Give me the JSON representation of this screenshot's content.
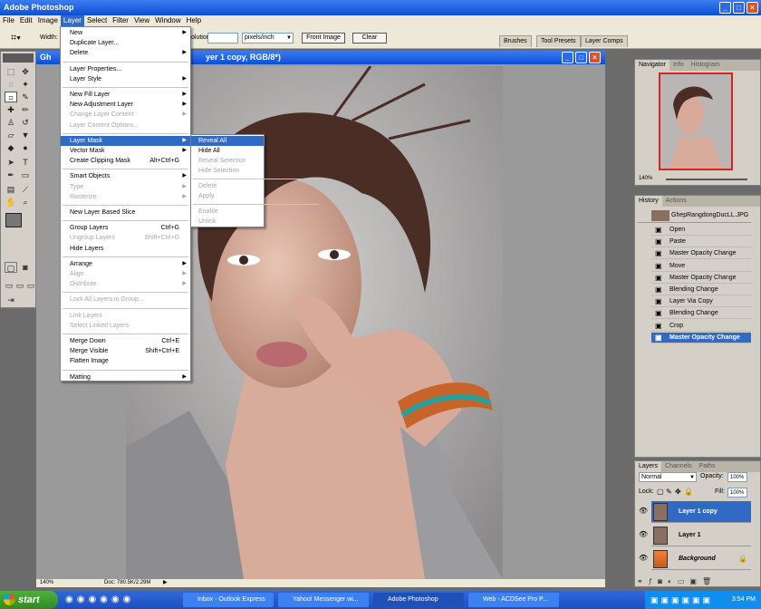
{
  "app": {
    "title": "Adobe Photoshop"
  },
  "menubar": [
    "File",
    "Edit",
    "Image",
    "Layer",
    "Select",
    "Filter",
    "View",
    "Window",
    "Help"
  ],
  "options": {
    "width_label": "Width:",
    "resolution_label": "olution:",
    "unit_select": "pixels/inch",
    "front_image_button": "Front Image",
    "clear_button": "Clear",
    "palette_tabs": [
      "Brushes",
      "Tool Presets",
      "Layer Comps"
    ]
  },
  "document": {
    "title": "Gh",
    "title_suffix": "yer 1 copy, RGB/8*)",
    "zoom": "140%",
    "doc_size": "Doc: 780.5K/2.29M"
  },
  "layer_menu": {
    "items": [
      {
        "label": "New",
        "arrow": "▶"
      },
      {
        "label": "Duplicate Layer..."
      },
      {
        "label": "Delete",
        "arrow": "▶"
      },
      {
        "sep": true
      },
      {
        "label": "Layer Properties..."
      },
      {
        "label": "Layer Style",
        "arrow": "▶"
      },
      {
        "sep": true
      },
      {
        "label": "New Fill Layer",
        "arrow": "▶"
      },
      {
        "label": "New Adjustment Layer",
        "arrow": "▶"
      },
      {
        "label": "Change Layer Content",
        "arrow": "▶",
        "disabled": true
      },
      {
        "label": "Layer Content Options...",
        "disabled": true
      },
      {
        "sep": true
      },
      {
        "label": "Layer Mask",
        "arrow": "▶",
        "highlight": true
      },
      {
        "label": "Vector Mask",
        "arrow": "▶"
      },
      {
        "label": "Create Clipping Mask",
        "shortcut": "Alt+Ctrl+G"
      },
      {
        "sep": true
      },
      {
        "label": "Smart Objects",
        "arrow": "▶"
      },
      {
        "label": "Type",
        "arrow": "▶",
        "disabled": true
      },
      {
        "label": "Rasterize",
        "arrow": "▶",
        "disabled": true
      },
      {
        "sep": true
      },
      {
        "label": "New Layer Based Slice"
      },
      {
        "sep": true
      },
      {
        "label": "Group Layers",
        "shortcut": "Ctrl+G"
      },
      {
        "label": "Ungroup Layers",
        "shortcut": "Shift+Ctrl+G",
        "disabled": true
      },
      {
        "label": "Hide Layers"
      },
      {
        "sep": true
      },
      {
        "label": "Arrange",
        "arrow": "▶"
      },
      {
        "label": "Align",
        "arrow": "▶",
        "disabled": true
      },
      {
        "label": "Distribute",
        "arrow": "▶",
        "disabled": true
      },
      {
        "sep": true
      },
      {
        "label": "Lock All Layers in Group...",
        "disabled": true
      },
      {
        "sep": true
      },
      {
        "label": "Link Layers",
        "disabled": true
      },
      {
        "label": "Select Linked Layers",
        "disabled": true
      },
      {
        "sep": true
      },
      {
        "label": "Merge Down",
        "shortcut": "Ctrl+E"
      },
      {
        "label": "Merge Visible",
        "shortcut": "Shift+Ctrl+E"
      },
      {
        "label": "Flatten Image"
      },
      {
        "sep": true
      },
      {
        "label": "Matting",
        "arrow": "▶"
      }
    ]
  },
  "layer_mask_submenu": {
    "items": [
      {
        "label": "Reveal All",
        "highlight": true
      },
      {
        "label": "Hide All"
      },
      {
        "label": "Reveal Selection",
        "disabled": true
      },
      {
        "label": "Hide Selection",
        "disabled": true
      },
      {
        "sep": true
      },
      {
        "label": "Delete",
        "disabled": true
      },
      {
        "label": "Apply",
        "disabled": true
      },
      {
        "sep": true
      },
      {
        "label": "Enable",
        "disabled": true
      },
      {
        "label": "Unlink",
        "disabled": true
      }
    ]
  },
  "navigator": {
    "tabs": [
      "Navigator",
      "Info",
      "Histogram"
    ],
    "zoom": "140%"
  },
  "history": {
    "tabs": [
      "History",
      "Actions"
    ],
    "snapshot": "GhepRangdongDucLL.JPG",
    "items": [
      "Open",
      "Paste",
      "Master Opacity Change",
      "Move",
      "Master Opacity Change",
      "Blending Change",
      "Layer Via Copy",
      "Blending Change",
      "Crop",
      "Master Opacity Change"
    ],
    "selected_index": 9
  },
  "layers": {
    "tabs": [
      "Layers",
      "Channels",
      "Paths"
    ],
    "blend_mode": "Normal",
    "opacity_label": "Opacity:",
    "opacity": "100%",
    "lock_label": "Lock:",
    "fill_label": "Fill:",
    "fill": "100%",
    "items": [
      {
        "name": "Layer 1 copy",
        "selected": true
      },
      {
        "name": "Layer 1"
      },
      {
        "name": "Background",
        "italic": true
      }
    ]
  },
  "taskbar": {
    "start": "start",
    "tasks": [
      "Inbox - Outlook Express",
      "Yahoo! Messenger wi...",
      "Adobe Photoshop",
      "Web - ACDSee Pro P..."
    ],
    "active_task": 2,
    "clock": "3:54 PM"
  }
}
